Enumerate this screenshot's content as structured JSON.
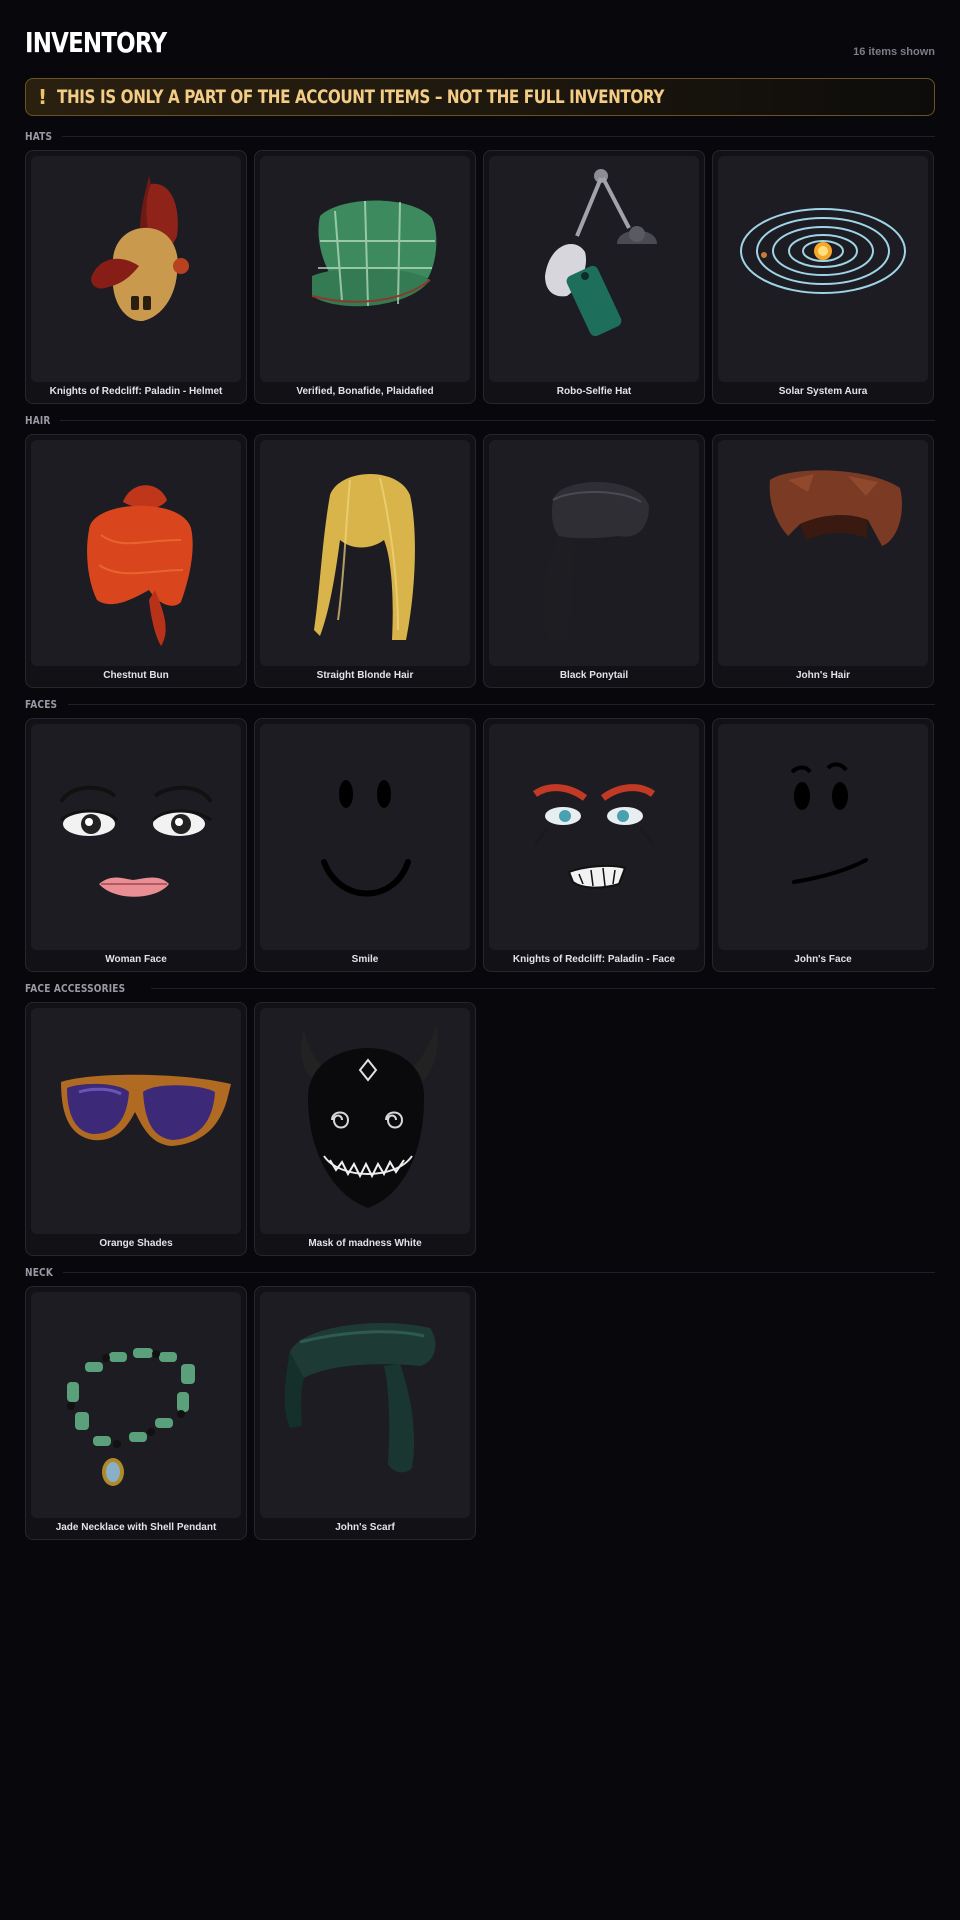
{
  "header": {
    "title": "INVENTORY",
    "count": "16 items shown"
  },
  "banner": {
    "icon": "!",
    "text": "THIS IS ONLY A PART OF THE ACCOUNT ITEMS – NOT THE FULL INVENTORY"
  },
  "sections": [
    {
      "label": "HATS",
      "items": [
        {
          "name": "Knights of Redcliff: Paladin - Helmet"
        },
        {
          "name": "Verified, Bonafide, Plaidafied"
        },
        {
          "name": "Robo-Selfie Hat"
        },
        {
          "name": "Solar System Aura"
        }
      ]
    },
    {
      "label": "HAIR",
      "items": [
        {
          "name": "Chestnut Bun"
        },
        {
          "name": "Straight Blonde Hair"
        },
        {
          "name": "Black Ponytail"
        },
        {
          "name": "John's Hair"
        }
      ]
    },
    {
      "label": "FACES",
      "items": [
        {
          "name": "Woman Face"
        },
        {
          "name": "Smile"
        },
        {
          "name": "Knights of Redcliff: Paladin - Face"
        },
        {
          "name": "John's Face"
        }
      ]
    },
    {
      "label": "FACE ACCESSORIES",
      "items": [
        {
          "name": "Orange Shades"
        },
        {
          "name": "Mask of madness White"
        }
      ]
    },
    {
      "label": "NECK",
      "items": [
        {
          "name": "Jade Necklace with Shell Pendant"
        },
        {
          "name": "John's Scarf"
        }
      ]
    }
  ],
  "colors": {
    "background": "#07070c",
    "card": "#111116",
    "thumb": "#1c1c22",
    "banner_text": "#f3cc86",
    "banner_border": "#6b5224"
  }
}
